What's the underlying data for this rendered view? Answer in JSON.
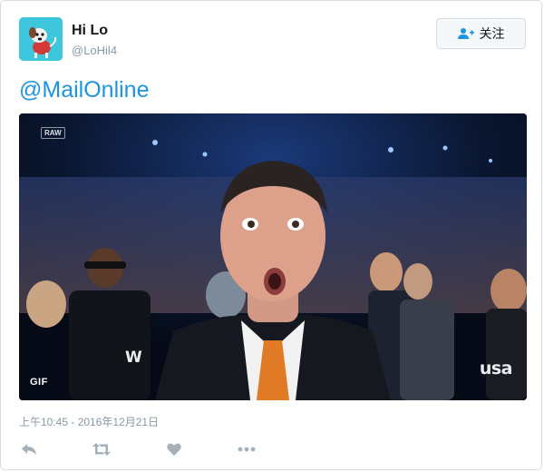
{
  "user": {
    "name": "Hi Lo",
    "handle": "@LoHil4",
    "avatar_icon": "cartoon-dog-avatar"
  },
  "follow_button": {
    "label": "关注",
    "icon": "follow-user-icon"
  },
  "tweet": {
    "text": "@MailOnline",
    "timestamp": "上午10:45 - 2016年12月21日"
  },
  "media": {
    "type": "animated-gif",
    "badge": "GIF",
    "broadcast_logo": "usa",
    "show_logo": "RAW",
    "wwe_logo": "W"
  },
  "actions": [
    {
      "icon": "reply-icon"
    },
    {
      "icon": "retweet-icon"
    },
    {
      "icon": "like-heart-icon"
    },
    {
      "icon": "more-icon"
    }
  ],
  "colors": {
    "link": "#1b95e0",
    "muted": "#8899a6",
    "border": "#d9dde1",
    "avatar_bg": "#3ec7dc"
  }
}
